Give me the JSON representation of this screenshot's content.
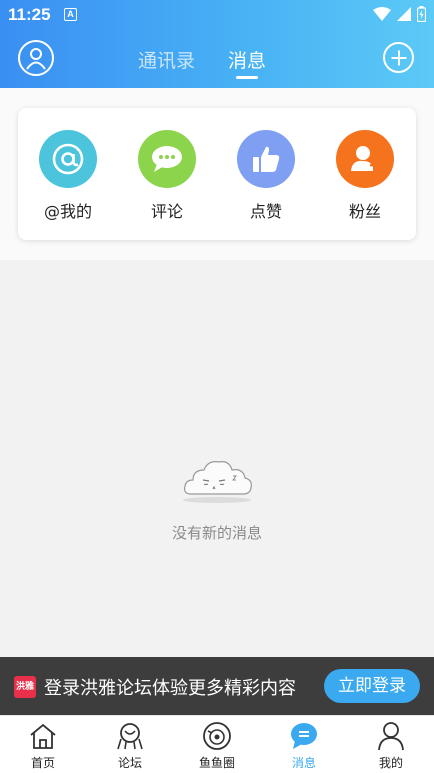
{
  "status_bar": {
    "time": "11:25",
    "notification_letter": "A"
  },
  "header": {
    "tabs": [
      {
        "label": "通讯录",
        "active": false
      },
      {
        "label": "消息",
        "active": true
      }
    ],
    "icons": {
      "left": "user-avatar-icon",
      "right": "add-circle-icon"
    }
  },
  "quick_actions": [
    {
      "label": "@我的",
      "icon": "at-sign-icon",
      "color": "#4bc4dc"
    },
    {
      "label": "评论",
      "icon": "chat-bubble-icon",
      "color": "#8cd44c"
    },
    {
      "label": "点赞",
      "icon": "thumbs-up-icon",
      "color": "#7f9ff2"
    },
    {
      "label": "粉丝",
      "icon": "add-follower-icon",
      "color": "#f6731e"
    }
  ],
  "empty_state": {
    "text": "没有新的消息",
    "icon": "sleepy-cloud-icon"
  },
  "login_banner": {
    "logo_text": "洪雅",
    "text": "登录洪雅论坛体验更多精彩内容",
    "button": "立即登录"
  },
  "bottom_nav": [
    {
      "label": "首页",
      "icon": "home-icon",
      "active": false
    },
    {
      "label": "论坛",
      "icon": "forum-icon",
      "active": false
    },
    {
      "label": "鱼鱼圈",
      "icon": "fish-circle-icon",
      "active": false
    },
    {
      "label": "消息",
      "icon": "message-icon",
      "active": true
    },
    {
      "label": "我的",
      "icon": "profile-icon",
      "active": false
    }
  ],
  "colors": {
    "accent": "#3aa9f0",
    "header_start": "#3a8ff2",
    "header_end": "#5ccaf6",
    "banner_bg": "#3d3d3d"
  }
}
